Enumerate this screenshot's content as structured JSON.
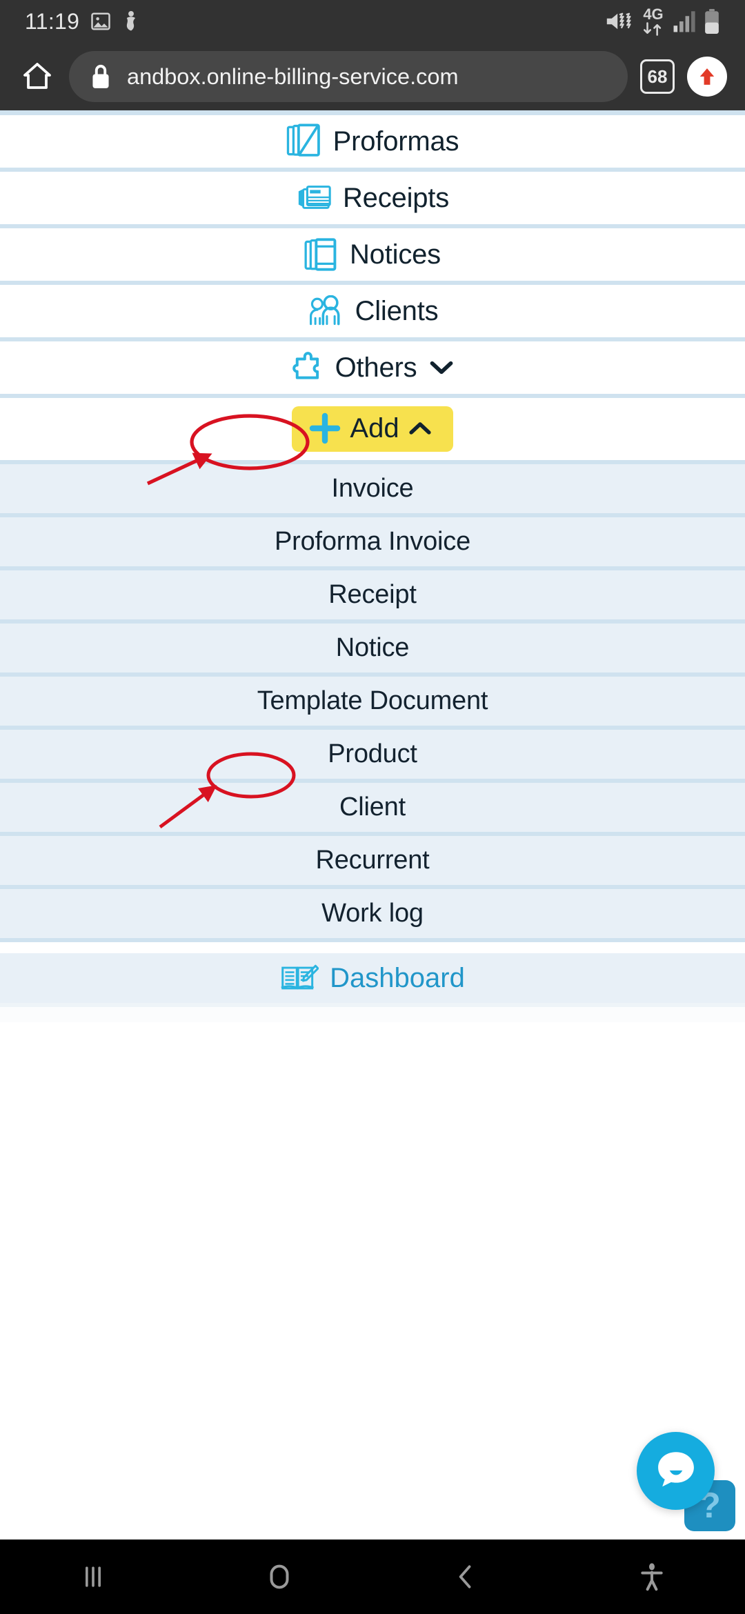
{
  "status_bar": {
    "time": "11:19",
    "left_icons": [
      "image-icon",
      "app-icon"
    ],
    "network_label": "4G",
    "right_icons": [
      "mute-vibrate-icon",
      "data-transfer-icon",
      "signal-bars-icon",
      "battery-icon"
    ]
  },
  "browser": {
    "home_icon": "home-icon",
    "lock_icon": "lock-icon",
    "url": "andbox.online-billing-service.com",
    "tab_count": "68",
    "update_icon": "update-arrow-icon"
  },
  "nav_items": [
    {
      "label": "Proformas",
      "icon": "proformas-stack-icon"
    },
    {
      "label": "Receipts",
      "icon": "receipts-stack-icon"
    },
    {
      "label": "Notices",
      "icon": "notices-stack-icon"
    },
    {
      "label": "Clients",
      "icon": "clients-people-icon"
    },
    {
      "label": "Others",
      "icon": "puzzle-piece-icon",
      "chevron": "chevron-down-icon"
    }
  ],
  "add_button": {
    "label": "Add",
    "plus_icon": "plus-icon",
    "chevron": "chevron-up-icon",
    "highlight_color": "#f7e14e",
    "expanded": true
  },
  "add_menu_items": [
    {
      "label": "Invoice"
    },
    {
      "label": "Proforma Invoice"
    },
    {
      "label": "Receipt"
    },
    {
      "label": "Notice"
    },
    {
      "label": "Template Document"
    },
    {
      "label": "Product"
    },
    {
      "label": "Client"
    },
    {
      "label": "Recurrent"
    },
    {
      "label": "Work log"
    }
  ],
  "dashboard": {
    "label": "Dashboard",
    "icon": "open-book-icon"
  },
  "chat_widget": {
    "chat_icon": "chat-bubble-icon",
    "help_label": "?",
    "color": "#15acdf"
  },
  "annotations": {
    "color": "#d81221",
    "ellipse_add_target": "Add",
    "ellipse_product_target": "Product",
    "arrow_count": "2"
  },
  "android_nav": {
    "buttons": [
      {
        "icon": "recents-icon"
      },
      {
        "icon": "home-circle-icon"
      },
      {
        "icon": "back-icon"
      },
      {
        "icon": "accessibility-icon"
      }
    ]
  }
}
